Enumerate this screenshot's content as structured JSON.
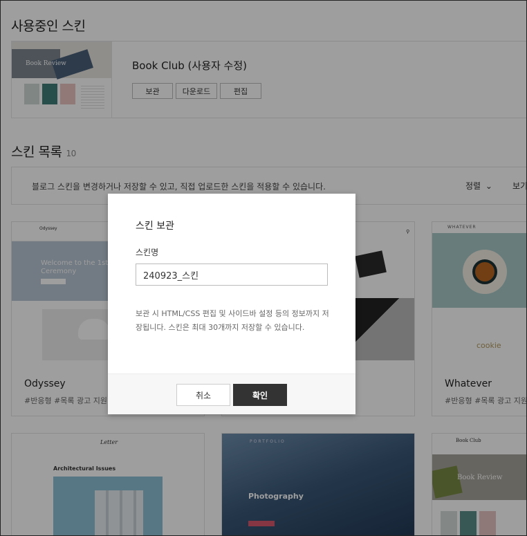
{
  "current_section": {
    "title": "사용중인 스킨",
    "skin_name": "Book Club (사용자 수정)",
    "thumb_caption": "Book Review",
    "buttons": {
      "archive": "보관",
      "download": "다운로드",
      "edit": "편집"
    }
  },
  "list_section": {
    "title": "스킨 목록",
    "count": "10",
    "info": "블로그 스킨을 변경하거나 저장할 수 있고, 직접 업로드한 스킨을 적용할 수 있습니다.",
    "sort_label": "정렬",
    "more_label": "보기"
  },
  "cards": [
    {
      "name": "Odyssey",
      "tags": "#반응형  #목록 광고 지원",
      "thumb_heading": "Welcome to the 1st Ceremony",
      "thumb_brand": "Odyssey"
    },
    {
      "name": "",
      "tags": ""
    },
    {
      "name": "Whatever",
      "tags": "#반응형  #목록 광고 지원",
      "thumb_brand": "WHATEVER",
      "thumb_word": "cookie"
    },
    {
      "name": "",
      "tags": "",
      "thumb_brand": "Letter",
      "thumb_heading": "Architectural Issues"
    },
    {
      "name": "",
      "tags": "",
      "thumb_brand": "PORTFOLIO",
      "thumb_heading": "Photography"
    },
    {
      "name": "",
      "tags": "",
      "thumb_brand": "Book Club",
      "thumb_heading": "Book Review"
    }
  ],
  "modal": {
    "title": "스킨 보관",
    "label": "스킨명",
    "input_value": "240923_스킨",
    "description": "보관 시 HTML/CSS 편집 및 사이드바 설정 등의 정보까지 저장됩니다. 스킨은 최대 30개까지 저장할 수 있습니다.",
    "cancel": "취소",
    "confirm": "확인"
  },
  "colors": {
    "overlay": "#000000",
    "confirm_bg": "#333333",
    "footer_bg": "#f7f7f8"
  }
}
